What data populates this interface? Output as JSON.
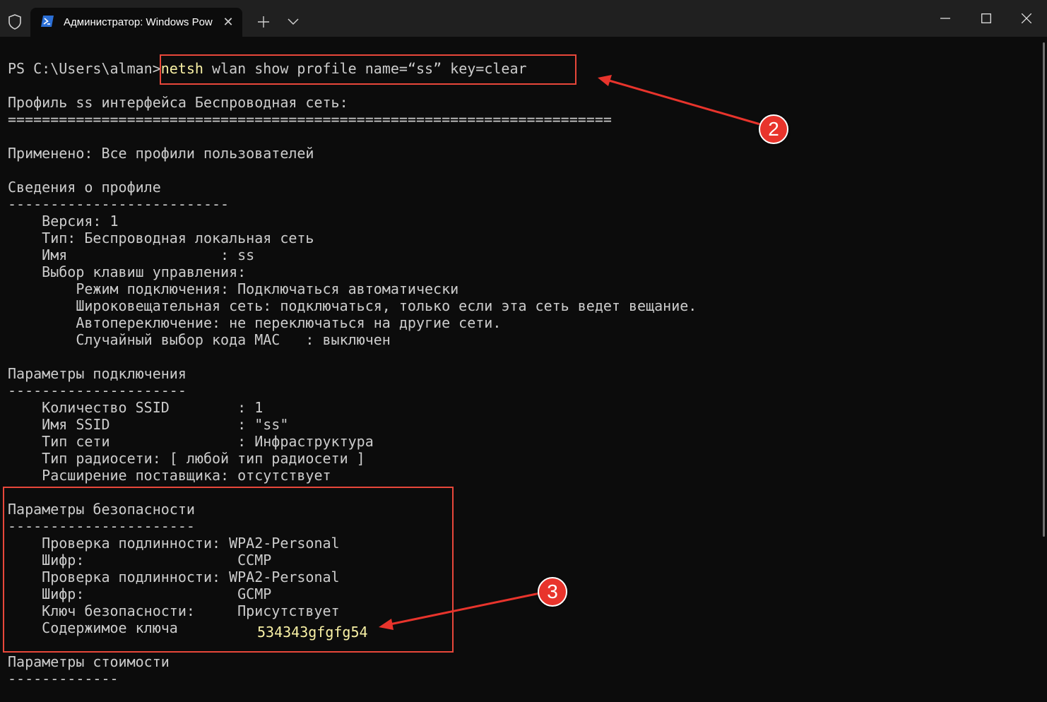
{
  "window": {
    "tab_title": "Администратор: Windows Pow",
    "tab_close": "✕",
    "new_tab": "+",
    "colors": {
      "titlebar": "#202020",
      "terminal_bg": "#0c0c0c",
      "text": "#cccccc",
      "highlight_text": "#f9f1a5",
      "annotation": "#e8342c"
    }
  },
  "terminal": {
    "prompt": "PS C:\\Users\\alman>",
    "command_keyword": "netsh",
    "command_args": " wlan show profile name=“ss” key=clear",
    "lines": [
      "Профиль ss интерфейса Беспроводная сеть:",
      "=======================================================================",
      "Применено: Все профили пользователей",
      "Сведения о профиле",
      "--------------------------",
      "    Версия: 1",
      "    Тип: Беспроводная локальная сеть",
      "    Имя                  : ss",
      "    Выбор клавиш управления:",
      "        Режим подключения: Подключаться автоматически",
      "        Широковещательная сеть: подключаться, только если эта сеть ведет вещание.",
      "        Автопереключение: не переключаться на другие сети.",
      "        Случайный выбор кода MAC   : выключен",
      "Параметры подключения",
      "---------------------",
      "    Количество SSID        : 1",
      "    Имя SSID               : \"ss\"",
      "    Тип сети               : Инфраструктура",
      "    Тип радиосети: [ любой тип радиосети ]",
      "    Расширение поставщика: отсутствует",
      "Параметры безопасности",
      "----------------------",
      "    Проверка подлинности: WPA2-Personal",
      "    Шифр:                  CCMP",
      "    Проверка подлинности: WPA2-Personal",
      "    Шифр:                  GCMP",
      "    Ключ безопасности:     Присутствует",
      "    Содержимое ключа",
      "Параметры стоимости",
      "-------------"
    ],
    "key_value": "534343gfgfg54"
  },
  "annotations": {
    "badge_2": "2",
    "badge_3": "3"
  },
  "icons": {
    "shield": "shield-icon",
    "powershell": "powershell-icon",
    "minimize": "minimize-icon",
    "maximize": "maximize-icon",
    "close": "close-icon",
    "dropdown": "chevron-down-icon"
  }
}
